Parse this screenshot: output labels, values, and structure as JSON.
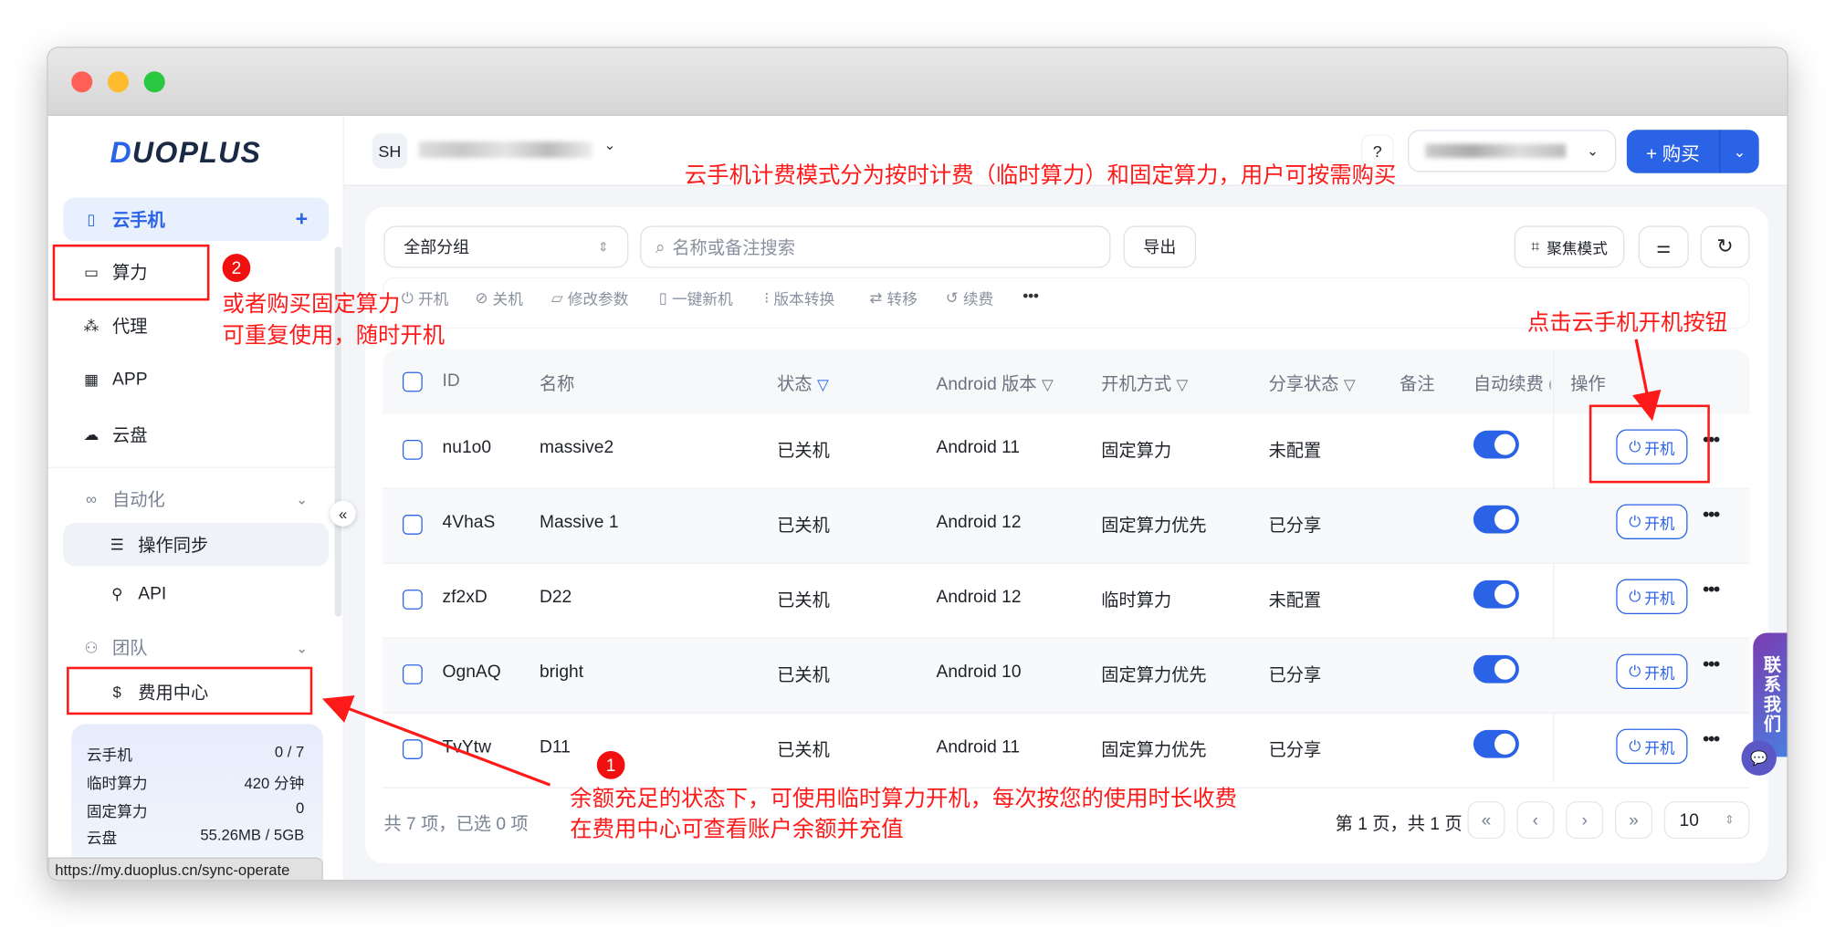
{
  "sidebar": {
    "logo": "DUOPLUS",
    "items": [
      {
        "label": "云手机",
        "icon": "phone-icon"
      },
      {
        "label": "算力",
        "icon": "monitor-icon"
      },
      {
        "label": "代理",
        "icon": "network-icon"
      },
      {
        "label": "APP",
        "icon": "apps-icon"
      },
      {
        "label": "云盘",
        "icon": "cloud-icon"
      }
    ],
    "automation": {
      "label": "自动化",
      "children": [
        "操作同步",
        "API"
      ]
    },
    "team": {
      "label": "团队",
      "children": [
        "费用中心"
      ]
    },
    "stats": [
      {
        "label": "云手机",
        "value": "0 / 7"
      },
      {
        "label": "临时算力",
        "value": "420 分钟"
      },
      {
        "label": "固定算力",
        "value": "0"
      },
      {
        "label": "云盘",
        "value": "55.26MB / 5GB"
      }
    ],
    "status_url": "https://my.duoplus.cn/sync-operate"
  },
  "header": {
    "avatar": "SH",
    "buy_label": "+ 购买"
  },
  "toolbar": {
    "group_select": "全部分组",
    "search_placeholder": "名称或备注搜索",
    "export": "导出",
    "focus_mode": "聚焦模式"
  },
  "actions": [
    "开机",
    "关机",
    "修改参数",
    "一键新机",
    "版本转换",
    "转移",
    "续费"
  ],
  "table": {
    "columns": [
      "ID",
      "名称",
      "状态",
      "Android 版本",
      "开机方式",
      "分享状态",
      "备注",
      "自动续费 (",
      "操作"
    ],
    "rows": [
      {
        "id": "nu1o0",
        "name": "massive2",
        "status": "已关机",
        "android": "Android 11",
        "mode": "固定算力",
        "share": "未配置",
        "auto_renew": true
      },
      {
        "id": "4VhaS",
        "name": "Massive 1",
        "status": "已关机",
        "android": "Android 12",
        "mode": "固定算力优先",
        "share": "已分享",
        "auto_renew": true
      },
      {
        "id": "zf2xD",
        "name": "D22",
        "status": "已关机",
        "android": "Android 12",
        "mode": "临时算力",
        "share": "未配置",
        "auto_renew": true
      },
      {
        "id": "OgnAQ",
        "name": "bright",
        "status": "已关机",
        "android": "Android 10",
        "mode": "固定算力优先",
        "share": "已分享",
        "auto_renew": true
      },
      {
        "id": "TvYtw",
        "name": "D11",
        "status": "已关机",
        "android": "Android 11",
        "mode": "固定算力优先",
        "share": "已分享",
        "auto_renew": true
      }
    ],
    "power_on_label": "开机"
  },
  "footer": {
    "summary": "共 7 项，已选 0 项",
    "page_info": "第 1 页，共 1 页",
    "page_size": "10"
  },
  "contact": "联系我们",
  "annotations": {
    "top": "云手机计费模式分为按时计费（临时算力）和固定算力，用户可按需购买",
    "badge2": "2",
    "note2_line1": "或者购买固定算力",
    "note2_line2": "可重复使用，随时开机",
    "click_note": "点击云手机开机按钮",
    "badge1": "1",
    "note1_line1": "余额充足的状态下，可使用临时算力开机，每次按您的使用时长收费",
    "note1_line2": "在费用中心可查看账户余额并充值"
  },
  "colors": {
    "accent": "#2b63e6",
    "annotation": "#ff1a1a"
  }
}
